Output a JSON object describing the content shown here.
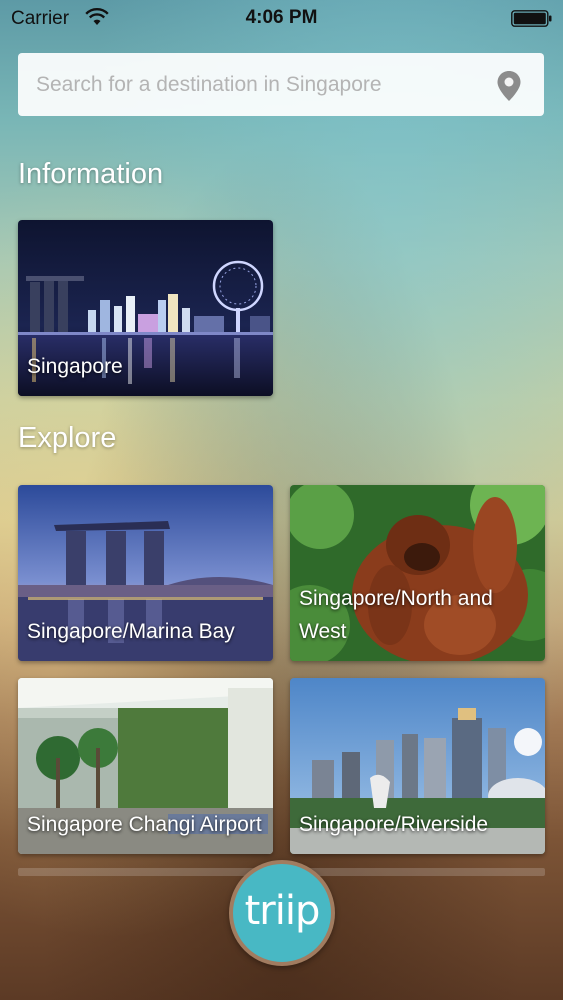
{
  "status_bar": {
    "carrier": "Carrier",
    "time": "4:06 PM"
  },
  "search": {
    "placeholder": "Search for a destination in Singapore",
    "icon": "location-pin-icon"
  },
  "sections": {
    "information": {
      "title": "Information",
      "cards": [
        {
          "label": "Singapore"
        }
      ]
    },
    "explore": {
      "title": "Explore",
      "cards": [
        {
          "label": "Singapore/Marina Bay"
        },
        {
          "label": "Singapore/North and West"
        },
        {
          "label": "Singapore Changi Airport"
        },
        {
          "label": "Singapore/Riverside"
        }
      ]
    }
  },
  "fab": {
    "logo_text": "triip",
    "color": "#48b8c4",
    "border_color": "#a17c60"
  }
}
